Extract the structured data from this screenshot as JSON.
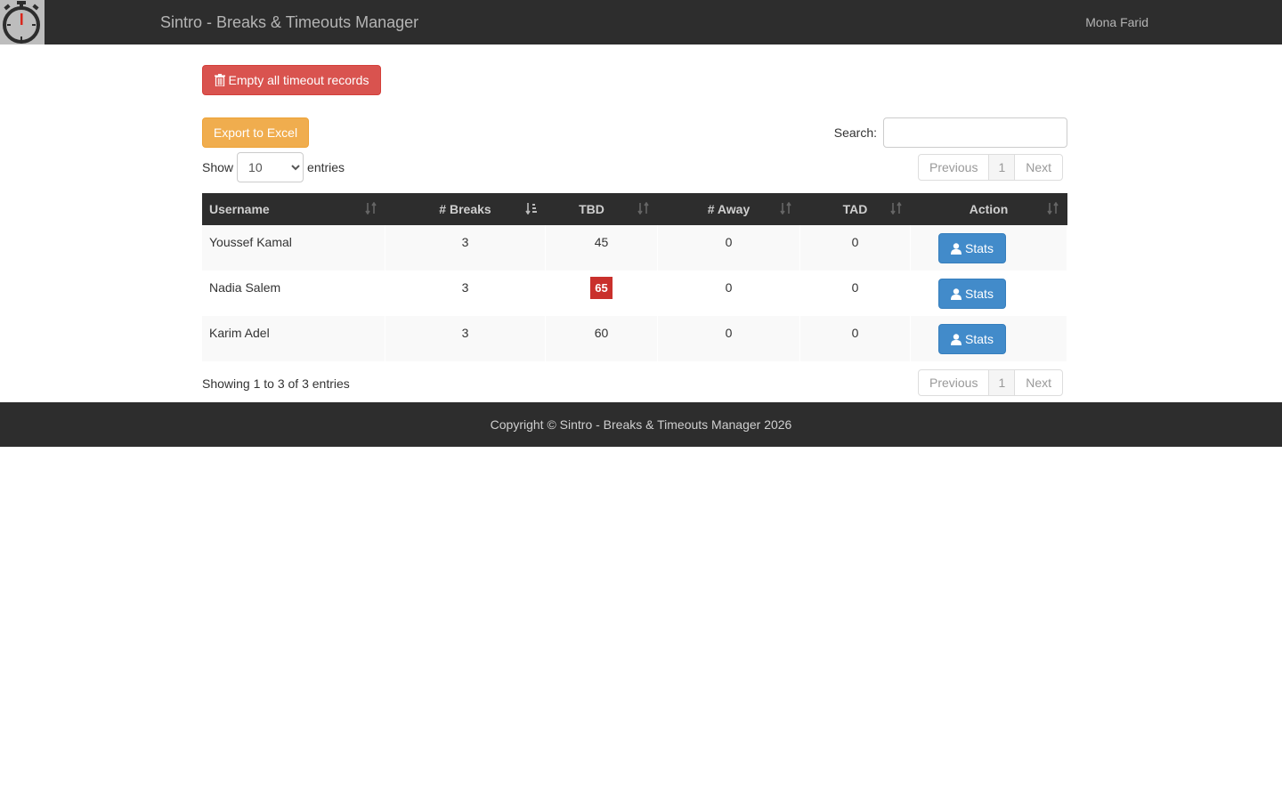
{
  "navbar": {
    "brand": "Sintro - Breaks & Timeouts Manager",
    "user": "Mona Farid"
  },
  "actions": {
    "empty_label": "Empty all timeout records",
    "export_label": "Export to Excel"
  },
  "length": {
    "show_label": "Show",
    "entries_label": "entries",
    "selected": "10"
  },
  "search": {
    "label": "Search:",
    "value": ""
  },
  "pagination": {
    "previous": "Previous",
    "page": "1",
    "next": "Next"
  },
  "table": {
    "columns": [
      "Username",
      "# Breaks",
      "TBD",
      "# Away",
      "TAD",
      "Action"
    ],
    "rows": [
      {
        "username": "Youssef Kamal",
        "breaks": "3",
        "tbd": "45",
        "tbd_alert": false,
        "away": "0",
        "tad": "0",
        "action": "Stats"
      },
      {
        "username": "Nadia Salem",
        "breaks": "3",
        "tbd": "65",
        "tbd_alert": true,
        "away": "0",
        "tad": "0",
        "action": "Stats"
      },
      {
        "username": "Karim Adel",
        "breaks": "3",
        "tbd": "60",
        "tbd_alert": false,
        "away": "0",
        "tad": "0",
        "action": "Stats"
      }
    ]
  },
  "info": "Showing 1 to 3 of 3 entries",
  "footer": "Copyright © Sintro - Breaks & Timeouts Manager 2026",
  "colors": {
    "navbar": "#2d2d2d",
    "danger": "#d9534f",
    "warning": "#f0ad4e",
    "primary": "#428bca",
    "alert_badge": "#c9302c"
  }
}
